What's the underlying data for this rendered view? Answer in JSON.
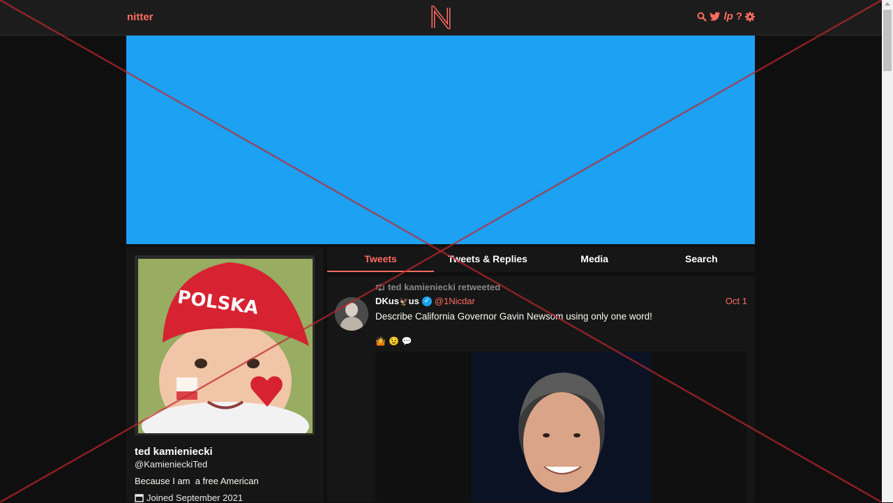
{
  "nav": {
    "brand": "nitter",
    "icons": [
      "search-icon",
      "twitter-bird-icon",
      "liberapay-icon",
      "help-icon",
      "settings-icon"
    ],
    "accent_color": "#ff6c60"
  },
  "banner": {
    "color": "#1da1f2"
  },
  "profile": {
    "fullname": "ted kamieniecki",
    "username": "@KamienieckiTed",
    "bio": "Because I am  a free American",
    "joined": "Joined September 2021",
    "avatar_text": "POLSKA"
  },
  "tabs": [
    {
      "label": "Tweets",
      "active": true
    },
    {
      "label": "Tweets & Replies",
      "active": false
    },
    {
      "label": "Media",
      "active": false
    },
    {
      "label": "Search",
      "active": false
    }
  ],
  "tweet": {
    "retweet_header": "ted kamieniecki retweeted",
    "fullname_a": "DKus",
    "fullname_b": "us",
    "username": "@1Nicdar",
    "date": "Oct 1",
    "text": "Describe California Governor Gavin Newsom using only one word!",
    "emojis": [
      "🤷",
      "😉",
      "💬"
    ]
  }
}
